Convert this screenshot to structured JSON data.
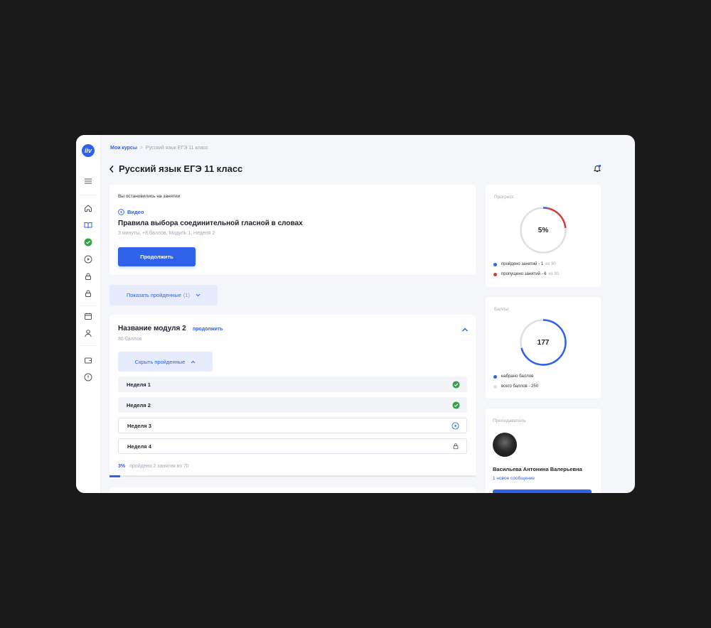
{
  "app": {
    "logo_text": "iiv"
  },
  "breadcrumb": {
    "items": [
      "Мои курсы",
      "Русский язык ЕГЭ 11 класс"
    ],
    "separator": ">"
  },
  "page": {
    "title": "Русский язык ЕГЭ 11 класс"
  },
  "sidebar": {
    "icons": [
      "menu-icon",
      "home-icon",
      "book-icon",
      "check-circle-icon",
      "play-icon",
      "lock-icon",
      "lock-icon",
      "calendar-icon",
      "user-icon",
      "wallet-icon",
      "info-icon"
    ],
    "active": "book-icon"
  },
  "continue_card": {
    "label": "Вы остановились на занятии",
    "type": "Видео",
    "lesson_title": "Правила выбора соединительной гласной в словах",
    "meta": "3 минуты, +8 баллов, Модуль 1, Неделя 2",
    "button": "Продолжить"
  },
  "show_passed": {
    "label": "Показать пройденные",
    "count": "(1)"
  },
  "module": {
    "title": "Название модуля 2",
    "link": "продолжить",
    "points": "86 баллов",
    "hide_passed_label": "Скрыть пройденные",
    "weeks": [
      {
        "label": "Неделя 1",
        "status": "done"
      },
      {
        "label": "Неделя 2",
        "status": "done"
      },
      {
        "label": "Неделя 3",
        "status": "in-progress"
      },
      {
        "label": "Неделя 4",
        "status": "locked"
      }
    ],
    "progress_pct": "3%",
    "progress_text": "пройдено 2 занятия из 70",
    "progress_value": 0.03
  },
  "progress_widget": {
    "label": "Прогресс",
    "value_text": "5%",
    "ring": {
      "completed": 1,
      "skipped": 6,
      "total": 30
    },
    "legend": [
      {
        "text": "пройдено занятий - 1",
        "suffix": "из 30",
        "color": "#2f62e8"
      },
      {
        "text": "пропущено занятий - 6",
        "suffix": "из 30",
        "color": "#d43b3b"
      }
    ]
  },
  "points_widget": {
    "label": "Баллы",
    "value_text": "177",
    "ring": {
      "earned": 177,
      "total": 250
    },
    "legend": [
      {
        "text": "набрано баллов",
        "color": "#2f62e8"
      },
      {
        "text": "всего баллов - 250",
        "color": "#dcdfe6"
      }
    ]
  },
  "teacher": {
    "label": "Преподаватель",
    "name": "Васильева Антонина Валерьевна",
    "message": "1 новое сообщение"
  },
  "colors": {
    "accent": "#2f62e8",
    "success": "#3aa14a",
    "danger": "#d43b3b"
  }
}
